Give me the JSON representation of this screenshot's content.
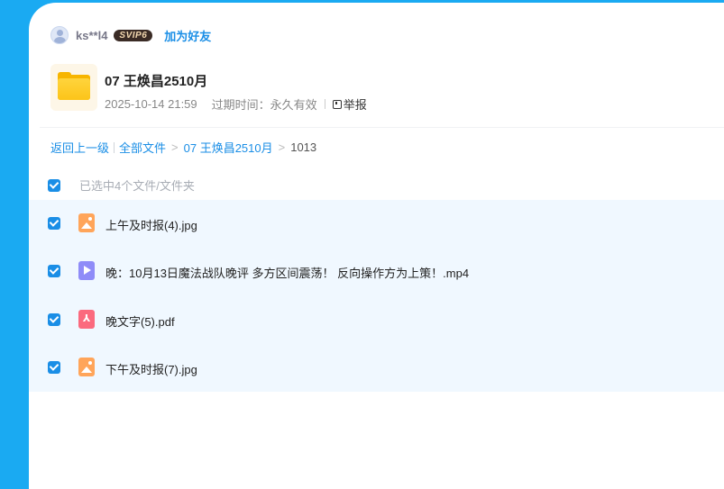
{
  "user": {
    "username": "ks**l4",
    "vip_badge": "SVIP6",
    "add_friend_label": "加为好友"
  },
  "share": {
    "title": "07 王焕昌2510月",
    "date": "2025-10-14 21:59",
    "expiry_label": "过期时间：",
    "expiry_value": "永久有效",
    "report_label": "举报"
  },
  "breadcrumb": {
    "back_label": "返回上一级",
    "root_label": "全部文件",
    "folder_label": "07 王焕昌2510月",
    "separator": ">",
    "current_label": "1013"
  },
  "selection": {
    "label": "已选中4个文件/文件夹",
    "checked": true
  },
  "files": [
    {
      "name": "上午及时报(4).jpg",
      "type": "image",
      "icon": "image-file-icon",
      "checked": true
    },
    {
      "name": "晚：10月13日魔法战队晚评 多方区间震荡！ 反向操作方为上策！.mp4",
      "type": "video",
      "icon": "video-file-icon",
      "checked": true
    },
    {
      "name": "晚文字(5).pdf",
      "type": "pdf",
      "icon": "pdf-file-icon",
      "checked": true
    },
    {
      "name": "下午及时报(7).jpg",
      "type": "image",
      "icon": "image-file-icon",
      "checked": true
    }
  ],
  "colors": {
    "accent": "#1a8ee6",
    "background": "#1aaaf2",
    "list_background": "#f0f8ff",
    "image_icon": "#ffa55a",
    "video_icon": "#8f8cf8",
    "pdf_icon": "#fb6a7e",
    "folder": "#fcc419"
  }
}
